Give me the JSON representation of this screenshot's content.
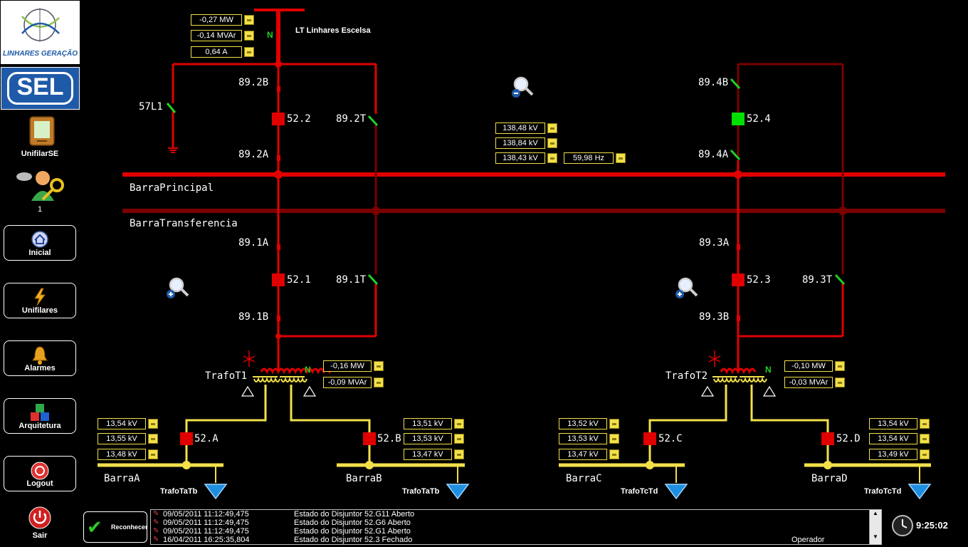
{
  "sidebar": {
    "logo_text": "LINHARES GERAÇÃO",
    "sel_logo": "SEL",
    "unifilar_se": "UnifilarSE",
    "user_count": "1",
    "buttons": {
      "inicial": "Inicial",
      "unifilares": "Unifilares",
      "alarmes": "Alarmes",
      "arquitetura": "Arquitetura",
      "logout": "Logout",
      "sair": "Sair"
    }
  },
  "line": {
    "name": "LT Linhares Escelsa",
    "neutral": "N",
    "mw": "-0,27 MW",
    "mvar": "-0,14 MVAr",
    "amp": "0,64 A"
  },
  "labels": {
    "sw_89_2b": "89.2B",
    "sw_57l1": "57L1",
    "br_52_2": "52.2",
    "sw_89_2t": "89.2T",
    "sw_89_2a": "89.2A",
    "sw_89_4b": "89.4B",
    "br_52_4": "52.4",
    "sw_89_4a": "89.4A",
    "barra_principal": "BarraPrincipal",
    "barra_transferencia": "BarraTransferencia",
    "sw_89_1a": "89.1A",
    "br_52_1": "52.1",
    "sw_89_1t": "89.1T",
    "sw_89_1b": "89.1B",
    "sw_89_3a": "89.3A",
    "br_52_3": "52.3",
    "sw_89_3t": "89.3T",
    "sw_89_3b": "89.3B",
    "trafo_t1": "TrafoT1",
    "trafo_t2": "TrafoT2",
    "neutral_t1": "N",
    "neutral_t2": "N",
    "br_52_a": "52.A",
    "br_52_b": "52.B",
    "br_52_c": "52.C",
    "br_52_d": "52.D",
    "barra_a": "BarraA",
    "barra_b": "BarraB",
    "barra_c": "BarraC",
    "barra_d": "BarraD",
    "trafo_tatb_1": "TrafoTaTb",
    "trafo_tatb_2": "TrafoTaTb",
    "trafo_tctd_1": "TrafoTcTd",
    "trafo_tctd_2": "TrafoTcTd"
  },
  "bus_main": {
    "kv1": "138,48 kV",
    "kv2": "138,84 kV",
    "kv3": "138,43 kV",
    "freq": "59,98 Hz"
  },
  "trafo_t1_meas": {
    "mw": "-0,16 MW",
    "mvar": "-0,09 MVAr"
  },
  "trafo_t2_meas": {
    "mw": "-0,10 MW",
    "mvar": "-0,03 MVAr"
  },
  "barra_a_meas": {
    "kv1": "13,54 kV",
    "kv2": "13,55 kV",
    "kv3": "13,48 kV"
  },
  "barra_b_meas": {
    "kv1": "13,51 kV",
    "kv2": "13,53 kV",
    "kv3": "13,47 kV"
  },
  "barra_c_meas": {
    "kv1": "13,52 kV",
    "kv2": "13,53 kV",
    "kv3": "13,47 kV"
  },
  "barra_d_meas": {
    "kv1": "13,54 kV",
    "kv2": "13,54 kV",
    "kv3": "13,49 kV"
  },
  "events": {
    "ack_label": "Reconhecer",
    "rows": [
      {
        "ts": "09/05/2011 11:12:49,475",
        "msg": "Estado do Disjuntor 52.G11 Aberto",
        "user": ""
      },
      {
        "ts": "09/05/2011 11:12:49,475",
        "msg": "Estado do Disjuntor 52.G6 Aberto",
        "user": ""
      },
      {
        "ts": "09/05/2011 11:12:49,475",
        "msg": "Estado do Disjuntor 52.G1 Aberto",
        "user": ""
      },
      {
        "ts": "16/04/2011 16:25:35,804",
        "msg": "Estado do Disjuntor 52.3 Fechado",
        "user": "Operador"
      }
    ]
  },
  "clock": {
    "time": "9:25:02"
  },
  "colors": {
    "energized": "#e00000",
    "deenergized": "#7a0000",
    "low_voltage": "#f2e04a",
    "breaker_closed": "#e00000",
    "breaker_open": "#00e000",
    "measurement_border": "#f2e04a"
  }
}
